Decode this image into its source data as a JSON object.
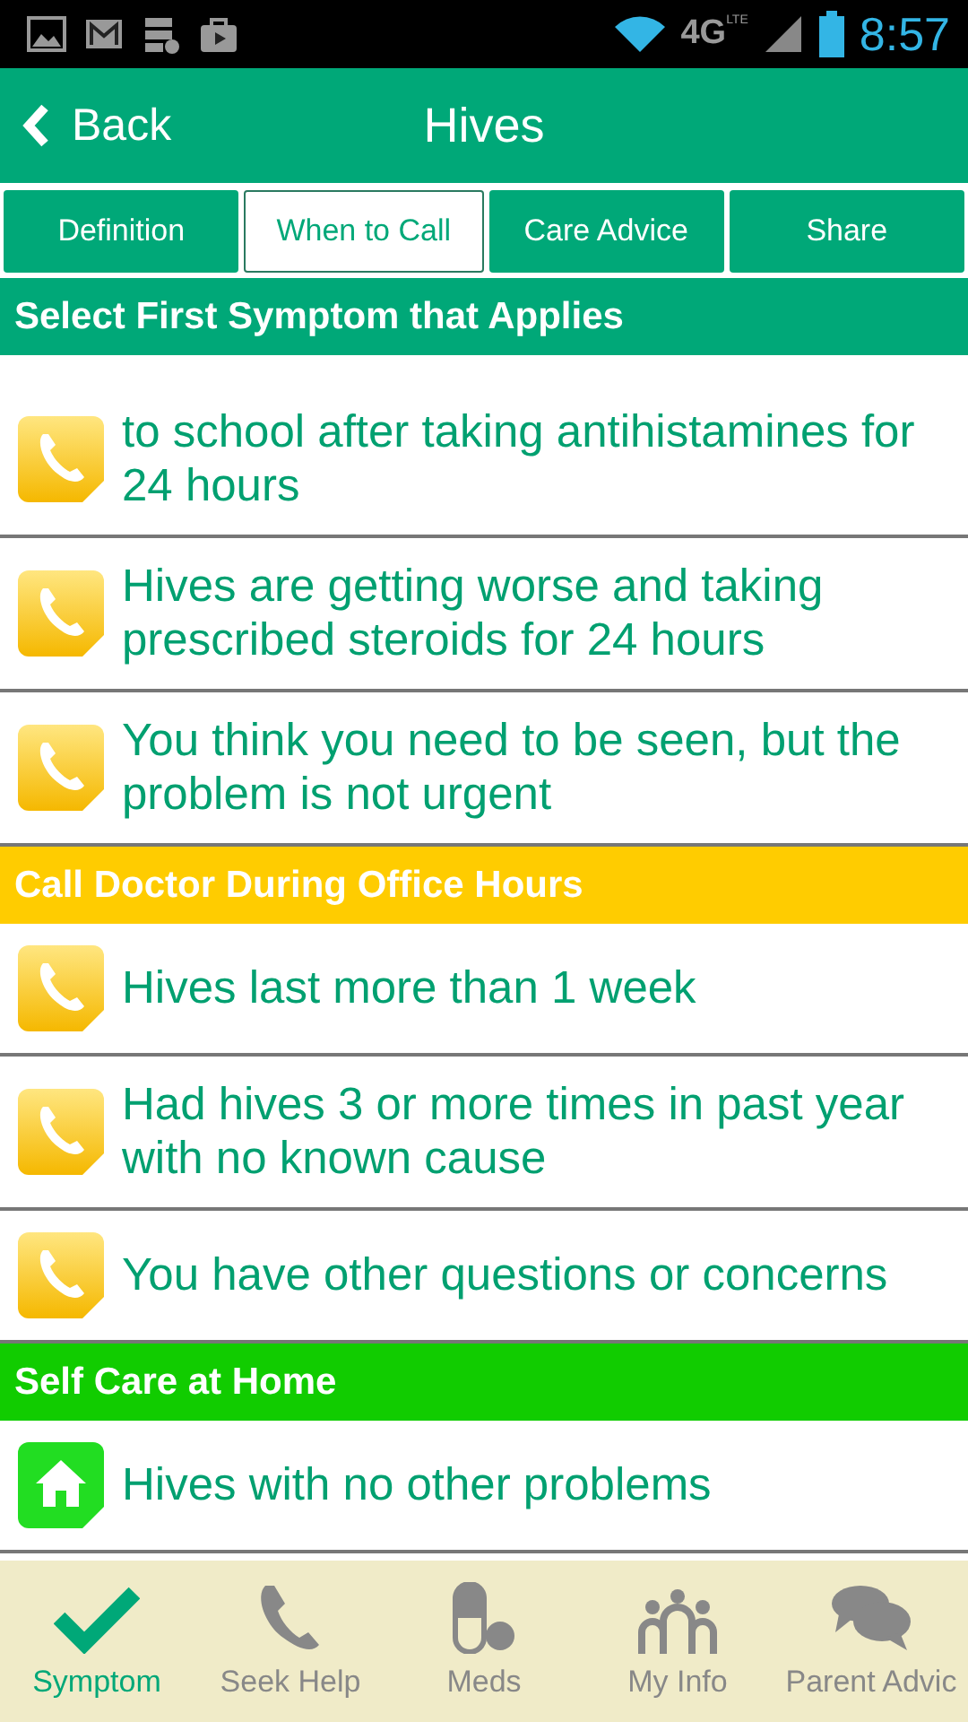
{
  "status_bar": {
    "network": "4G",
    "network_sub": "LTE",
    "time": "8:57"
  },
  "header": {
    "back": "Back",
    "title": "Hives"
  },
  "tabs": [
    {
      "label": "Definition",
      "selected": false
    },
    {
      "label": "When to Call",
      "selected": true
    },
    {
      "label": "Care Advice",
      "selected": false
    },
    {
      "label": "Share",
      "selected": false
    }
  ],
  "sections": [
    {
      "title": "Select First Symptom that Applies",
      "color": "#00a878",
      "items": [
        {
          "kind": "phone",
          "text": "to school after taking antihistamines for 24 hours"
        },
        {
          "kind": "phone",
          "text": "Hives are getting worse and taking prescribed steroids for 24 hours"
        },
        {
          "kind": "phone",
          "text": "You think you need to be seen, but the problem is not urgent"
        }
      ]
    },
    {
      "title": "Call Doctor During Office Hours",
      "color": "#ffcc00",
      "items": [
        {
          "kind": "phone",
          "text": "Hives last more than 1 week"
        },
        {
          "kind": "phone",
          "text": "Had hives 3 or more times in past year with no known cause"
        },
        {
          "kind": "phone",
          "text": "You have other questions or concerns"
        }
      ]
    },
    {
      "title": "Self Care at Home",
      "color": "#11cc00",
      "items": [
        {
          "kind": "home",
          "text": "Hives with no other problems"
        }
      ]
    }
  ],
  "nav": [
    {
      "kind": "check",
      "label": "Symptom",
      "selected": true
    },
    {
      "kind": "phone",
      "label": "Seek Help",
      "selected": false
    },
    {
      "kind": "pill",
      "label": "Meds",
      "selected": false
    },
    {
      "kind": "people",
      "label": "My Info",
      "selected": false
    },
    {
      "kind": "chat",
      "label": "Parent Advic",
      "selected": false
    }
  ]
}
